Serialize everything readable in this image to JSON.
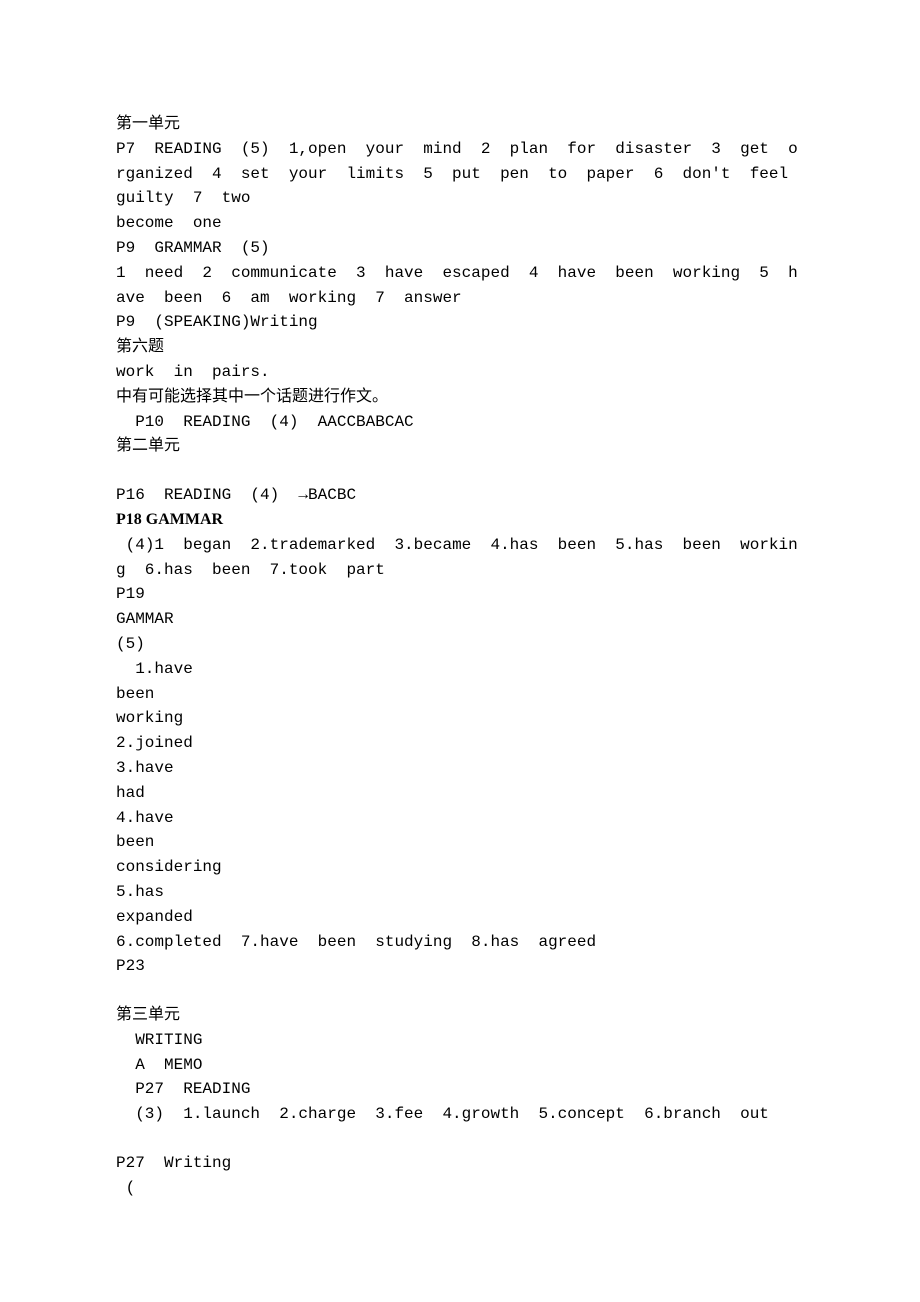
{
  "lines": [
    {
      "text": "第一单元",
      "cls": "line cn"
    },
    {
      "text": "P7  READING  (5)  1,open  your  mind  2  plan  for  disaster  3  get  organized  4  set  your  limits  5  put  pen  to  paper  6  don't  feel  guilty  7  two",
      "cls": "line mono"
    },
    {
      "text": "become  one",
      "cls": "line mono"
    },
    {
      "text": "P9  GRAMMAR  (5)",
      "cls": "line mono"
    },
    {
      "text": "1  need  2  communicate  3  have  escaped  4  have  been  working  5  have  been  6  am  working  7  answer",
      "cls": "line mono"
    },
    {
      "text": "P9  (SPEAKING)Writing",
      "cls": "line mono"
    },
    {
      "text": "第六题",
      "cls": "line cn"
    },
    {
      "text": "work  in  pairs.",
      "cls": "line mono"
    },
    {
      "text": "中有可能选择其中一个话题进行作文。",
      "cls": "line cn"
    },
    {
      "text": "  P10  READING  (4)  AACCBABCAC",
      "cls": "line mono"
    },
    {
      "text": "第二单元",
      "cls": "line cn"
    },
    {
      "text": "",
      "cls": "blank"
    },
    {
      "text": "P16  READING  (4)  →BACBC",
      "cls": "line mono"
    },
    {
      "text": "P18 GAMMAR",
      "cls": "line bold"
    },
    {
      "text": " (4)1  began  2.trademarked  3.became  4.has  been  5.has  been  working  6.has  been  7.took  part",
      "cls": "line mono"
    },
    {
      "text": "P19",
      "cls": "line mono"
    },
    {
      "text": "GAMMAR",
      "cls": "line mono"
    },
    {
      "text": "(5)",
      "cls": "line mono"
    },
    {
      "text": "  1.have",
      "cls": "line mono"
    },
    {
      "text": "been",
      "cls": "line mono"
    },
    {
      "text": "working",
      "cls": "line mono"
    },
    {
      "text": "2.joined",
      "cls": "line mono"
    },
    {
      "text": "3.have",
      "cls": "line mono"
    },
    {
      "text": "had",
      "cls": "line mono"
    },
    {
      "text": "4.have",
      "cls": "line mono"
    },
    {
      "text": "been",
      "cls": "line mono"
    },
    {
      "text": "considering",
      "cls": "line mono"
    },
    {
      "text": "5.has",
      "cls": "line mono"
    },
    {
      "text": "expanded",
      "cls": "line mono"
    },
    {
      "text": "6.completed  7.have  been  studying  8.has  agreed",
      "cls": "line mono"
    },
    {
      "text": "P23",
      "cls": "line mono"
    },
    {
      "text": "",
      "cls": "blank"
    },
    {
      "text": "第三单元",
      "cls": "line cn"
    },
    {
      "text": "  WRITING",
      "cls": "line mono"
    },
    {
      "text": "  A  MEMO",
      "cls": "line mono"
    },
    {
      "text": "  P27  READING",
      "cls": "line mono"
    },
    {
      "text": "  (3)  1.launch  2.charge  3.fee  4.growth  5.concept  6.branch  out",
      "cls": "line mono"
    },
    {
      "text": "",
      "cls": "blank"
    },
    {
      "text": "P27  Writing",
      "cls": "line mono"
    },
    {
      "text": " (",
      "cls": "line mono"
    }
  ]
}
